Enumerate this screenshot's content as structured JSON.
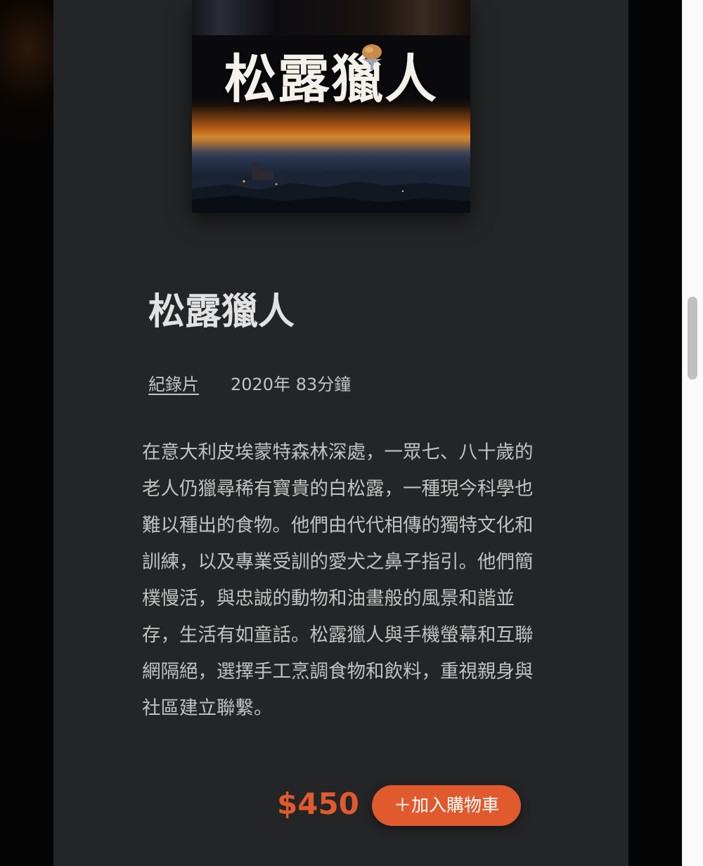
{
  "poster": {
    "title_text": "松露獵人",
    "icon": "truffle-image"
  },
  "product": {
    "title": "松露獵人",
    "genre": "紀錄片",
    "year_length": "2020年 83分鐘",
    "description": "在意大利皮埃蒙特森林深處，一眾七、八十歲的老人仍獵尋稀有寶貴的白松露，一種現今科學也難以種出的食物。他們由代代相傳的獨特文化和訓練，以及專業受訓的愛犬之鼻子指引。他們簡樸慢活，與忠誠的動物和油畫般的風景和諧並存，生活有如童話。松露獵人與手機螢幕和互聯網隔絕，選擇手工烹調食物和飲料，重視親身與社區建立聯繫。",
    "price": "$450",
    "cart_button_label": "＋加入購物車"
  },
  "colors": {
    "accent": "#e05a2e",
    "panel": "#232526",
    "text": "#c2c2c2"
  }
}
